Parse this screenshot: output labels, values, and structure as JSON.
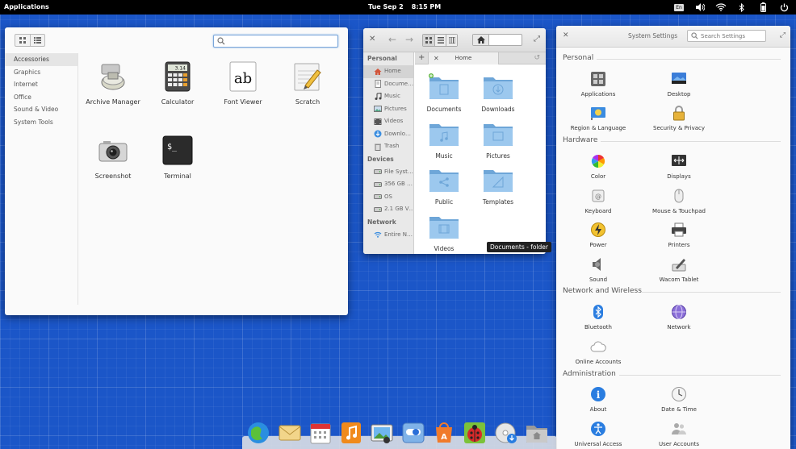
{
  "top_panel": {
    "applications_label": "Applications",
    "date": "Tue Sep  2",
    "time": "8:15 PM",
    "keyboard_layout": "En"
  },
  "apps_menu": {
    "search": {
      "value": "",
      "placeholder": ""
    },
    "categories": [
      "Accessories",
      "Graphics",
      "Internet",
      "Office",
      "Sound & Video",
      "System Tools"
    ],
    "selected_category": "Accessories",
    "apps": [
      {
        "label": "Archive Manager",
        "icon": "archive-manager-icon"
      },
      {
        "label": "Calculator",
        "icon": "calculator-icon"
      },
      {
        "label": "Font Viewer",
        "icon": "font-viewer-icon"
      },
      {
        "label": "Scratch",
        "icon": "scratch-icon"
      },
      {
        "label": "Screenshot",
        "icon": "screenshot-icon"
      },
      {
        "label": "Terminal",
        "icon": "terminal-icon"
      }
    ],
    "calculator_display": "3.14",
    "terminal_prompt": "$_",
    "font_glyphs": "ab"
  },
  "files": {
    "path_value": "",
    "tab_label": "Home",
    "sidebar": {
      "personal_heading": "Personal",
      "personal": [
        "Home",
        "Docume…",
        "Music",
        "Pictures",
        "Videos",
        "Downlo…",
        "Trash"
      ],
      "devices_heading": "Devices",
      "devices": [
        "File Syst…",
        "356 GB …",
        "OS",
        "2.1 GB V…"
      ],
      "network_heading": "Network",
      "network": [
        "Entire N…"
      ]
    },
    "folders": [
      "Documents",
      "Downloads",
      "Music",
      "Pictures",
      "Public",
      "Templates",
      "Videos"
    ],
    "tooltip": "Documents - folder"
  },
  "settings": {
    "title": "System Settings",
    "search_placeholder": "Search Settings",
    "sections": [
      {
        "title": "Personal",
        "items": [
          "Applications",
          "Desktop",
          "Region & Language",
          "Security & Privacy"
        ]
      },
      {
        "title": "Hardware",
        "items": [
          "Color",
          "Displays",
          "Keyboard",
          "Mouse & Touchpad",
          "Power",
          "Printers",
          "Sound",
          "Wacom Tablet"
        ]
      },
      {
        "title": "Network and Wireless",
        "items": [
          "Bluetooth",
          "Network",
          "Online Accounts"
        ]
      },
      {
        "title": "Administration",
        "items": [
          "About",
          "Date & Time",
          "Universal Access",
          "User Accounts"
        ]
      }
    ]
  },
  "dock": {
    "items": [
      "web-browser-icon",
      "mail-icon",
      "calendar-icon",
      "music-player-icon",
      "photos-icon",
      "system-settings-icon",
      "app-center-icon",
      "bug-tracker-icon",
      "disk-installer-icon",
      "files-icon"
    ]
  },
  "colors": {
    "desktop": "#1b56c8",
    "accent_blue": "#4a90d9",
    "folder_blue": "#8ec0e8"
  }
}
